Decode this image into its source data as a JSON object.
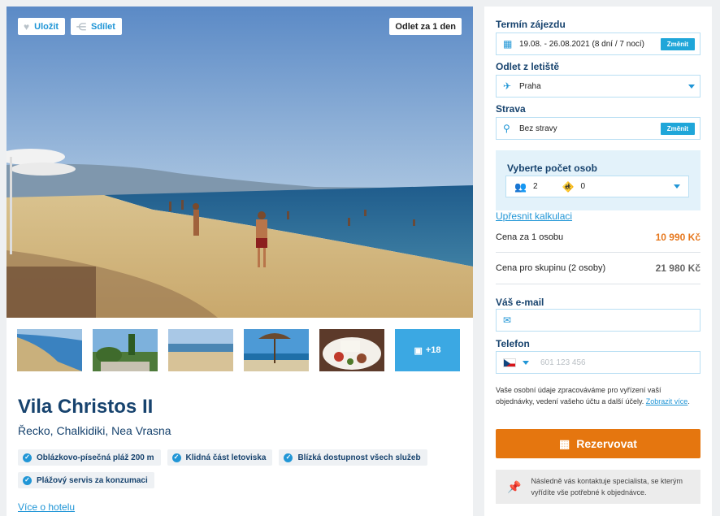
{
  "hero": {
    "save_label": "Uložit",
    "share_label": "Sdílet",
    "departure_badge": "Odlet za 1 den"
  },
  "gallery": {
    "more_label": "+18"
  },
  "hotel": {
    "name": "Vila Christos II",
    "location": "Řecko, Chalkidiki, Nea Vrasna",
    "features": [
      "Oblázkovo-písečná pláž 200 m",
      "Klidná část letoviska",
      "Blízká dostupnost všech služeb",
      "Plážový servis za konzumaci"
    ],
    "more_link": "Více o hotelu"
  },
  "booking": {
    "term_label": "Termín zájezdu",
    "term_value": "19.08. - 26.08.2021 (8 dní / 7 nocí)",
    "change_label": "Změnit",
    "departure_label": "Odlet z letiště",
    "departure_value": "Praha",
    "board_label": "Strava",
    "board_value": "Bez stravy",
    "persons_title": "Vyberte počet osob",
    "adults": "2",
    "children": "0",
    "refine_link": "Upřesnit kalkulaci",
    "price_per_person_label": "Cena za 1 osobu",
    "price_per_person": "10 990 Kč",
    "price_group_label": "Cena pro skupinu (2 osoby)",
    "price_group": "21 980 Kč",
    "email_label": "Váš e-mail",
    "email_value": "",
    "phone_label": "Telefon",
    "phone_placeholder": "601 123 456",
    "privacy_text": "Vaše osobní údaje zpracováváme pro vyřízení vaší objednávky, vedení vašeho účtu a další účely.",
    "privacy_link": "Zobrazit více",
    "reserve_label": "Rezervovat",
    "note_text": "Následně vás kontaktuje specialista, se kterým vyřídíte vše potřebné k objednávce."
  },
  "colors": {
    "accent_blue": "#1f95d6",
    "heading_navy": "#17436e",
    "reserve_orange": "#e5760f",
    "price_orange": "#e6781e"
  }
}
